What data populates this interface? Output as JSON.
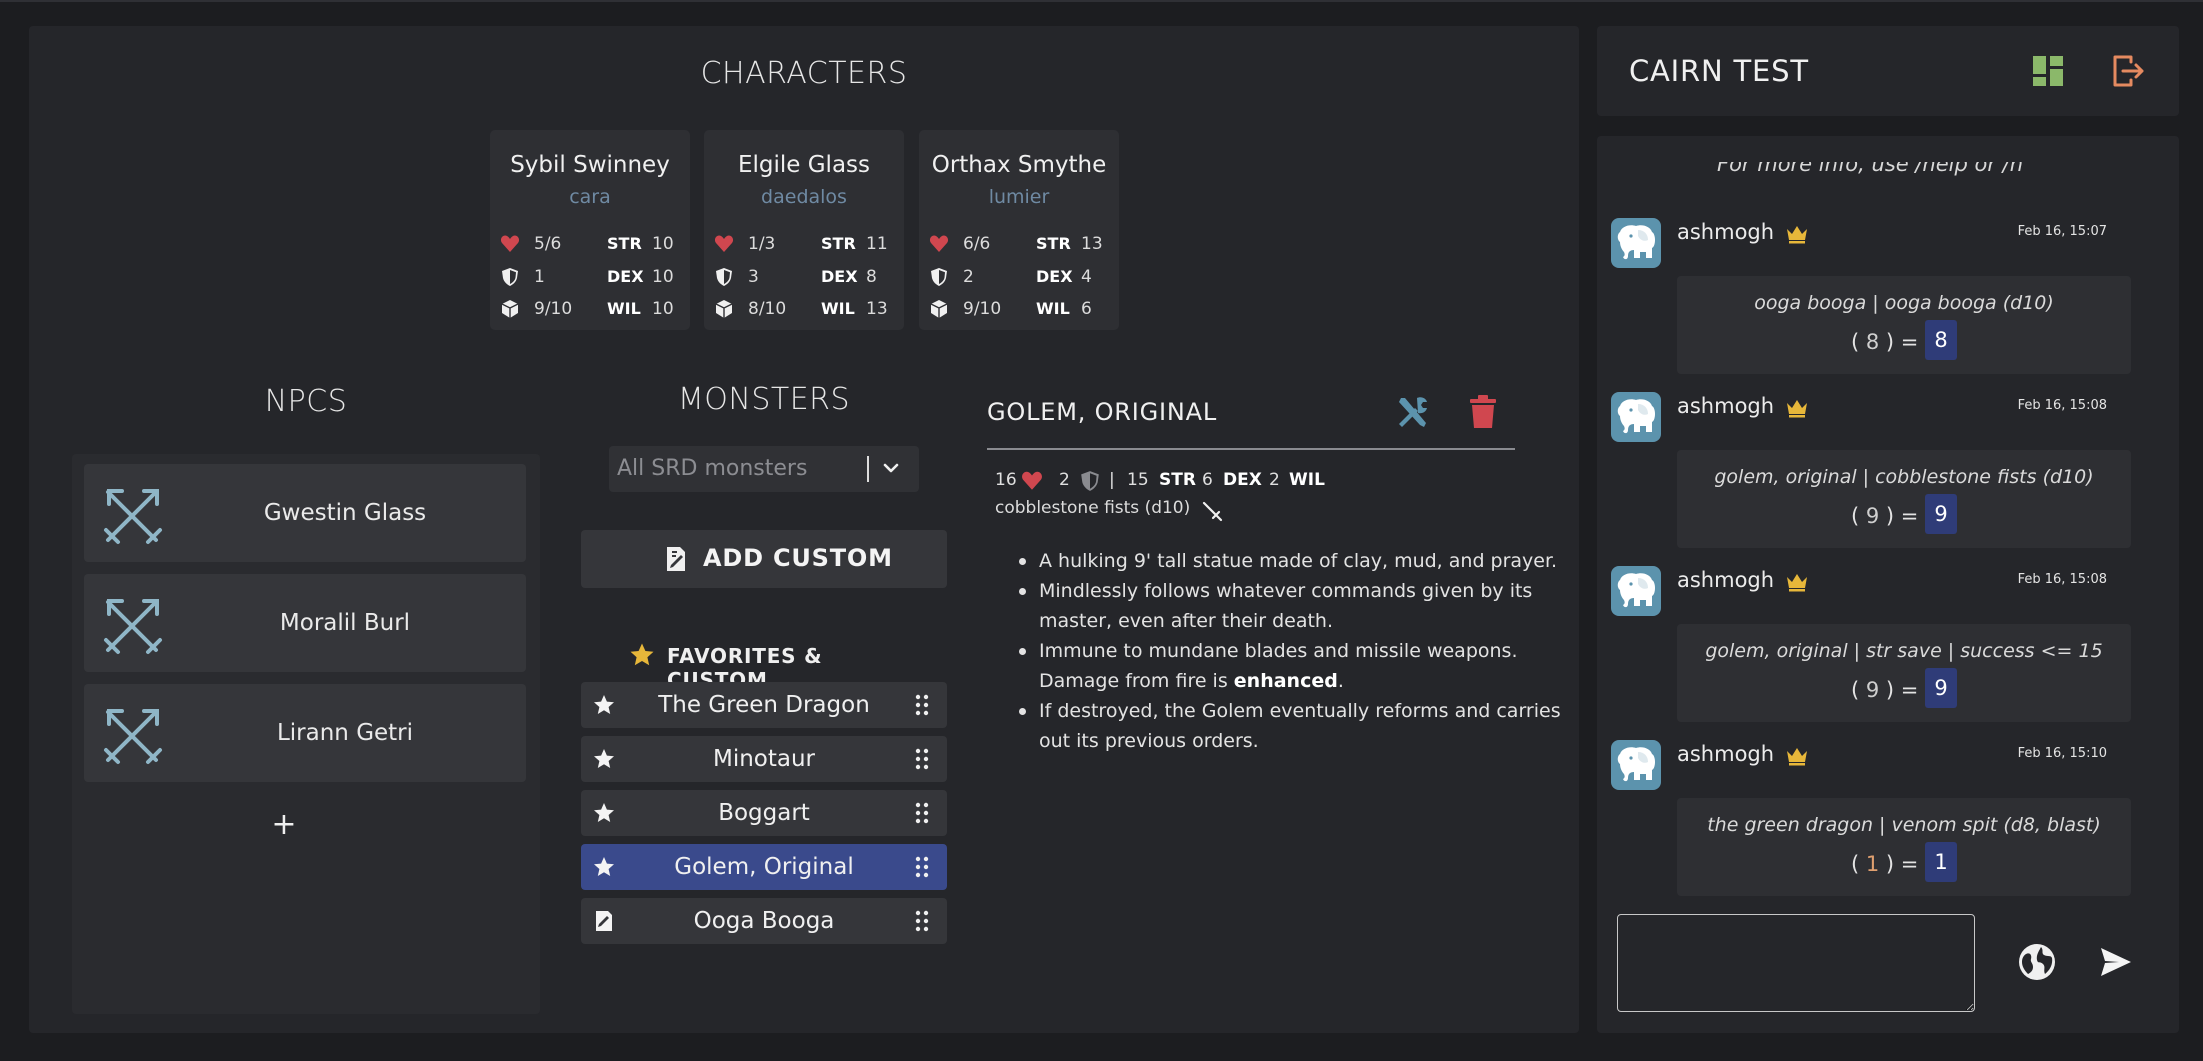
{
  "characters": {
    "title": "CHARACTERS",
    "cards": [
      {
        "name": "Sybil Swinney",
        "player": "cara",
        "hp": "5/6",
        "armor": "1",
        "inv": "9/10",
        "str": "10",
        "dex": "10",
        "wil": "10"
      },
      {
        "name": "Elgile Glass",
        "player": "daedalos",
        "hp": "1/3",
        "armor": "3",
        "inv": "8/10",
        "str": "11",
        "dex": "8",
        "wil": "13"
      },
      {
        "name": "Orthax Smythe",
        "player": "lumier",
        "hp": "6/6",
        "armor": "2",
        "inv": "9/10",
        "str": "13",
        "dex": "4",
        "wil": "6"
      }
    ],
    "labels": {
      "str": "STR",
      "dex": "DEX",
      "wil": "WIL"
    }
  },
  "npcs": {
    "title": "NPCS",
    "items": [
      "Gwestin Glass",
      "Moralil Burl",
      "Lirann Getri"
    ],
    "add": "+"
  },
  "monsters": {
    "title": "MONSTERS",
    "select_placeholder": "All SRD monsters",
    "add_custom": "ADD CUSTOM",
    "favorites_title": "FAVORITES & CUSTOM",
    "favorites": [
      {
        "name": "The Green Dragon",
        "icon": "star-icon"
      },
      {
        "name": "Minotaur",
        "icon": "star-icon"
      },
      {
        "name": "Boggart",
        "icon": "star-icon"
      },
      {
        "name": "Golem, Original",
        "icon": "star-icon",
        "selected": true
      },
      {
        "name": "Ooga Booga",
        "icon": "custom-monster-icon"
      }
    ]
  },
  "detail": {
    "title": "GOLEM, ORIGINAL",
    "hp": "16",
    "armor": "2",
    "sep": "|",
    "str": "15",
    "dex": "6",
    "wil": "2",
    "attack": "cobblestone fists (d10)",
    "desc": [
      "A hulking 9' tall statue made of clay, mud, and prayer.",
      "Mindlessly follows whatever commands given by its master, even after their death.",
      "Immune to mundane blades and missile weapons. Damage from fire is",
      "If destroyed, the Golem eventually reforms and carries out its previous orders."
    ],
    "desc_bold": "enhanced",
    "desc_end": "."
  },
  "sidebar": {
    "title": "CAIRN TEST",
    "chat_cut": "For more info, use /help or /h"
  },
  "chat": [
    {
      "user": "ashmogh",
      "time": "Feb 16, 15:07",
      "expr": "ooga booga | ooga booga (d10)",
      "roll": "8",
      "total": "8"
    },
    {
      "user": "ashmogh",
      "time": "Feb 16, 15:08",
      "expr": "golem, original | cobblestone fists (d10)",
      "roll": "9",
      "total": "9"
    },
    {
      "user": "ashmogh",
      "time": "Feb 16, 15:08",
      "expr": "golem, original | str save | success <= 15",
      "roll": "9",
      "total": "9"
    },
    {
      "user": "ashmogh",
      "time": "Feb 16, 15:10",
      "expr": "the green dragon | venom spit (d8, blast)",
      "roll": "1",
      "total": "1"
    }
  ],
  "colors": {
    "accent_selected": "#3a4a8c",
    "heart": "#d0474f",
    "crown": "#e7b73a",
    "layout_icon": "#8bb86a",
    "exit_icon": "#e58a60",
    "npc_icon": "#8fb6c7",
    "total_bg": "#2f3c78",
    "delete_icon": "#d0474f",
    "edit_icon": "#5c93ad"
  }
}
